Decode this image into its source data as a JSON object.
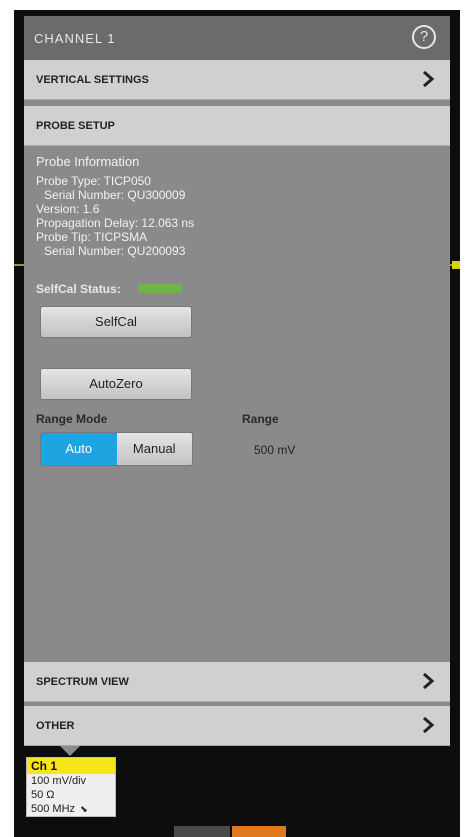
{
  "window": {
    "title": "CHANNEL 1",
    "help_icon": "help-circle-icon"
  },
  "sections": {
    "vertical": "VERTICAL SETTINGS",
    "probe": "PROBE SETUP",
    "spectrum": "SPECTRUM VIEW",
    "other": "OTHER",
    "chevron_icon": "chevron-right-icon"
  },
  "probe_info": {
    "heading": "Probe Information",
    "probe_type": "Probe Type: TICP050",
    "probe_serial": "Serial Number: QU300009",
    "version": "Version: 1.6",
    "propagation_delay": "Propagation Delay: 12.063 ns",
    "probe_tip": "Probe Tip: TICPSMA",
    "tip_serial": "Serial Number: QU200093"
  },
  "selfcal": {
    "status_label": "SelfCal Status:",
    "status_color": "#6fb44b",
    "selfcal_button": "SelfCal",
    "autozero_button": "AutoZero"
  },
  "range": {
    "mode_label": "Range Mode",
    "mode_options": [
      "Auto",
      "Manual"
    ],
    "mode_selected": "Auto",
    "range_label": "Range",
    "range_value": "500 mV",
    "accent_color": "#1ea4e0"
  },
  "channel_badge": {
    "name": "Ch 1",
    "scale": "100 mV/div",
    "impedance": "50 Ω",
    "bandwidth": "500 MHz",
    "bandwidth_icon": "bandwidth-limit-icon",
    "badge_color": "#f7e51a"
  }
}
